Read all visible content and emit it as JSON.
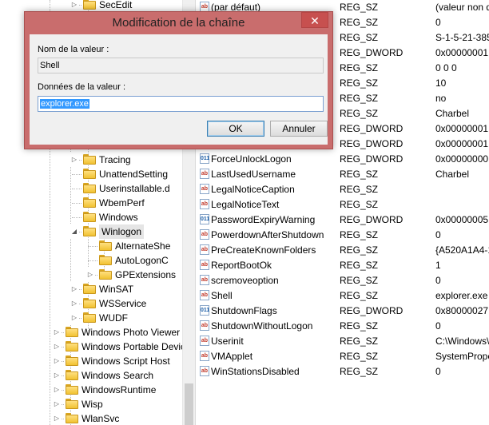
{
  "tree": {
    "items": [
      {
        "label": "SecEdit",
        "level": 2,
        "expander": "▷"
      },
      {
        "label": "Tracing",
        "level": 2,
        "expander": "▷"
      },
      {
        "label": "UnattendSetting",
        "level": 2,
        "expander": ""
      },
      {
        "label": "Userinstallable.d",
        "level": 2,
        "expander": ""
      },
      {
        "label": "WbemPerf",
        "level": 2,
        "expander": ""
      },
      {
        "label": "Windows",
        "level": 2,
        "expander": ""
      },
      {
        "label": "Winlogon",
        "level": 2,
        "expander": "◢",
        "selected": true
      },
      {
        "label": "AlternateShe",
        "level": 3,
        "expander": ""
      },
      {
        "label": "AutoLogonC",
        "level": 3,
        "expander": ""
      },
      {
        "label": "GPExtensions",
        "level": 3,
        "expander": "▷"
      },
      {
        "label": "WinSAT",
        "level": 2,
        "expander": "▷"
      },
      {
        "label": "WSService",
        "level": 2,
        "expander": "▷"
      },
      {
        "label": "WUDF",
        "level": 2,
        "expander": "▷"
      },
      {
        "label": "Windows Photo Viewer",
        "level": 1,
        "expander": "▷"
      },
      {
        "label": "Windows Portable Devic",
        "level": 1,
        "expander": "▷"
      },
      {
        "label": "Windows Script Host",
        "level": 1,
        "expander": "▷"
      },
      {
        "label": "Windows Search",
        "level": 1,
        "expander": "▷"
      },
      {
        "label": "WindowsRuntime",
        "level": 1,
        "expander": "▷"
      },
      {
        "label": "Wisp",
        "level": 1,
        "expander": "▷"
      },
      {
        "label": "WlanSvc",
        "level": 1,
        "expander": "▷"
      }
    ]
  },
  "values": {
    "rows": [
      {
        "name": "(par défaut)",
        "type": "REG_SZ",
        "data": "(valeur non d",
        "icon": "ab"
      },
      {
        "name": "",
        "type": "REG_SZ",
        "data": "0",
        "icon": ""
      },
      {
        "name": "",
        "type": "REG_SZ",
        "data": "S-1-5-21-385",
        "icon": ""
      },
      {
        "name": "",
        "type": "REG_DWORD",
        "data": "0x00000001 (",
        "icon": ""
      },
      {
        "name": "",
        "type": "REG_SZ",
        "data": "0 0 0",
        "icon": ""
      },
      {
        "name": "",
        "type": "REG_SZ",
        "data": "10",
        "icon": ""
      },
      {
        "name": "",
        "type": "REG_SZ",
        "data": "no",
        "icon": ""
      },
      {
        "name": "",
        "type": "REG_SZ",
        "data": "Charbel",
        "icon": ""
      },
      {
        "name": "",
        "type": "REG_DWORD",
        "data": "0x00000001 (",
        "icon": ""
      },
      {
        "name": "",
        "type": "REG_DWORD",
        "data": "0x00000001 (",
        "icon": ""
      },
      {
        "name": "ForceUnlockLogon",
        "type": "REG_DWORD",
        "data": "0x00000000 (",
        "icon": "bin"
      },
      {
        "name": "LastUsedUsername",
        "type": "REG_SZ",
        "data": "Charbel",
        "icon": "ab"
      },
      {
        "name": "LegalNoticeCaption",
        "type": "REG_SZ",
        "data": "",
        "icon": "ab"
      },
      {
        "name": "LegalNoticeText",
        "type": "REG_SZ",
        "data": "",
        "icon": "ab"
      },
      {
        "name": "PasswordExpiryWarning",
        "type": "REG_DWORD",
        "data": "0x00000005 (",
        "icon": "bin"
      },
      {
        "name": "PowerdownAfterShutdown",
        "type": "REG_SZ",
        "data": "0",
        "icon": "ab"
      },
      {
        "name": "PreCreateKnownFolders",
        "type": "REG_SZ",
        "data": "{A520A1A4-1",
        "icon": "ab"
      },
      {
        "name": "ReportBootOk",
        "type": "REG_SZ",
        "data": "1",
        "icon": "ab"
      },
      {
        "name": "scremoveoption",
        "type": "REG_SZ",
        "data": "0",
        "icon": "ab"
      },
      {
        "name": "Shell",
        "type": "REG_SZ",
        "data": "explorer.exe",
        "icon": "ab"
      },
      {
        "name": "ShutdownFlags",
        "type": "REG_DWORD",
        "data": "0x80000027 (",
        "icon": "bin"
      },
      {
        "name": "ShutdownWithoutLogon",
        "type": "REG_SZ",
        "data": "0",
        "icon": "ab"
      },
      {
        "name": "Userinit",
        "type": "REG_SZ",
        "data": "C:\\Windows\\",
        "icon": "ab"
      },
      {
        "name": "VMApplet",
        "type": "REG_SZ",
        "data": "SystemPrope",
        "icon": "ab"
      },
      {
        "name": "WinStationsDisabled",
        "type": "REG_SZ",
        "data": "0",
        "icon": "ab"
      }
    ]
  },
  "dialog": {
    "title": "Modification de la chaîne",
    "close_glyph": "✕",
    "name_label": "Nom de la valeur :",
    "name_value": "Shell",
    "data_label": "Données de la valeur :",
    "data_value": "explorer.exe",
    "ok_label": "OK",
    "cancel_label": "Annuler"
  }
}
